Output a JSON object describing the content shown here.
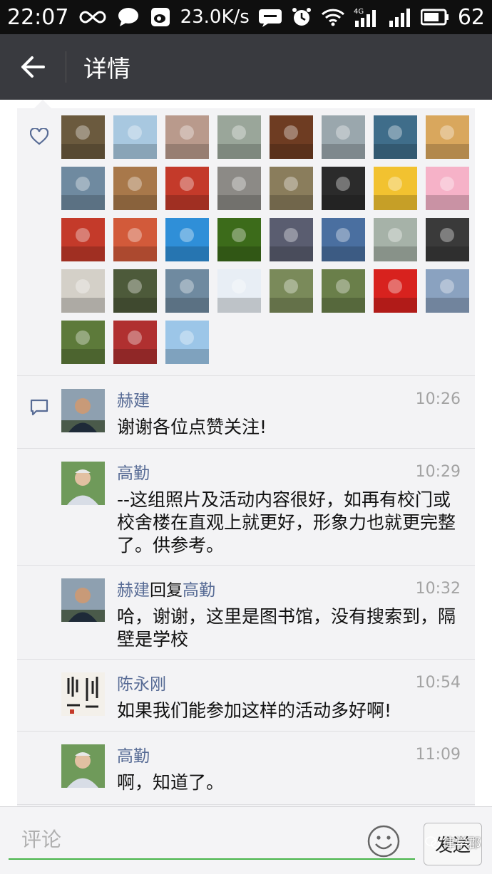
{
  "status_bar": {
    "time": "22:07",
    "speed": "23.0K/s",
    "network": "4G",
    "battery": "62"
  },
  "header": {
    "title": "详情"
  },
  "likes": {
    "avatars": [
      "avatar-man-with-camera",
      "avatar-snowy-trees",
      "avatar-woman-in-park",
      "avatar-pig-statue",
      "avatar-horse-painting",
      "avatar-sea-island",
      "avatar-palm-trees",
      "avatar-woman-smiling",
      "avatar-young-man",
      "avatar-red-gate",
      "avatar-flower-heart",
      "avatar-man-glasses",
      "avatar-sculpture",
      "avatar-group-suits",
      "avatar-luffy",
      "avatar-patrick",
      "avatar-red-seal",
      "avatar-stamp-cartoon",
      "avatar-airplane",
      "avatar-sunflower",
      "avatar-man-reading",
      "avatar-man-portrait",
      "avatar-girl-white-dress",
      "avatar-girl-dark",
      "avatar-stamp-portrait",
      "avatar-man-trees",
      "avatar-cyclist",
      "avatar-1500-logo",
      "avatar-man-garden",
      "avatar-couple-flowers",
      "avatar-china-flag",
      "avatar-man-building",
      "avatar-orchid",
      "avatar-red-tree",
      "avatar-woman-back"
    ],
    "colors": [
      "#6b5a3e",
      "#a8c8e0",
      "#b99a8c",
      "#9aa69a",
      "#6e3c22",
      "#9aa7ad",
      "#3f6d8a",
      "#d9a75d",
      "#6f8aa0",
      "#a8784a",
      "#c43a2a",
      "#8c8a86",
      "#8a7d5c",
      "#2b2b2b",
      "#f2c230",
      "#f6b2c8",
      "#c43a2a",
      "#d25a3a",
      "#2f8fd8",
      "#3c6b1a",
      "#5a5d70",
      "#4a6fa0",
      "#a6b2a8",
      "#3a3a3a",
      "#d4d0c8",
      "#4d5a3a",
      "#6f8aa0",
      "#e8eef5",
      "#7a8a5a",
      "#6a7f4a",
      "#d8221e",
      "#8aa2c0",
      "#5d7a3a",
      "#b03030",
      "#9cc6e8"
    ]
  },
  "comments": [
    {
      "name": "赫建",
      "reply_word": "",
      "reply_to": "",
      "time": "10:26",
      "text": "谢谢各位点赞关注!",
      "avatar_color": "#6a8095"
    },
    {
      "name": "高勤",
      "reply_word": "",
      "reply_to": "",
      "time": "10:29",
      "text": "--这组照片及活动内容很好，如再有校门或校舍楼在直观上就更好，形象力也就更完整了。供参考。",
      "avatar_color": "#7a9a6a"
    },
    {
      "name": "赫建",
      "reply_word": "回复",
      "reply_to": "高勤",
      "time": "10:32",
      "text": "哈，谢谢，这里是图书馆，没有搜索到，隔壁是学校",
      "avatar_color": "#6a8095"
    },
    {
      "name": "陈永刚",
      "reply_word": "",
      "reply_to": "",
      "time": "10:54",
      "text": "如果我们能参加这样的活动多好啊!",
      "avatar_color": "#f3f0ea"
    },
    {
      "name": "高勤",
      "reply_word": "",
      "reply_to": "",
      "time": "11:09",
      "text": "啊，知道了。",
      "avatar_color": "#7a9a6a"
    }
  ],
  "composer": {
    "placeholder": "评论",
    "send_label": "发送"
  },
  "watermark": "律学郡",
  "colors": {
    "link": "#576b95",
    "navbar": "#393a3f",
    "input_underline": "#48b54a"
  }
}
